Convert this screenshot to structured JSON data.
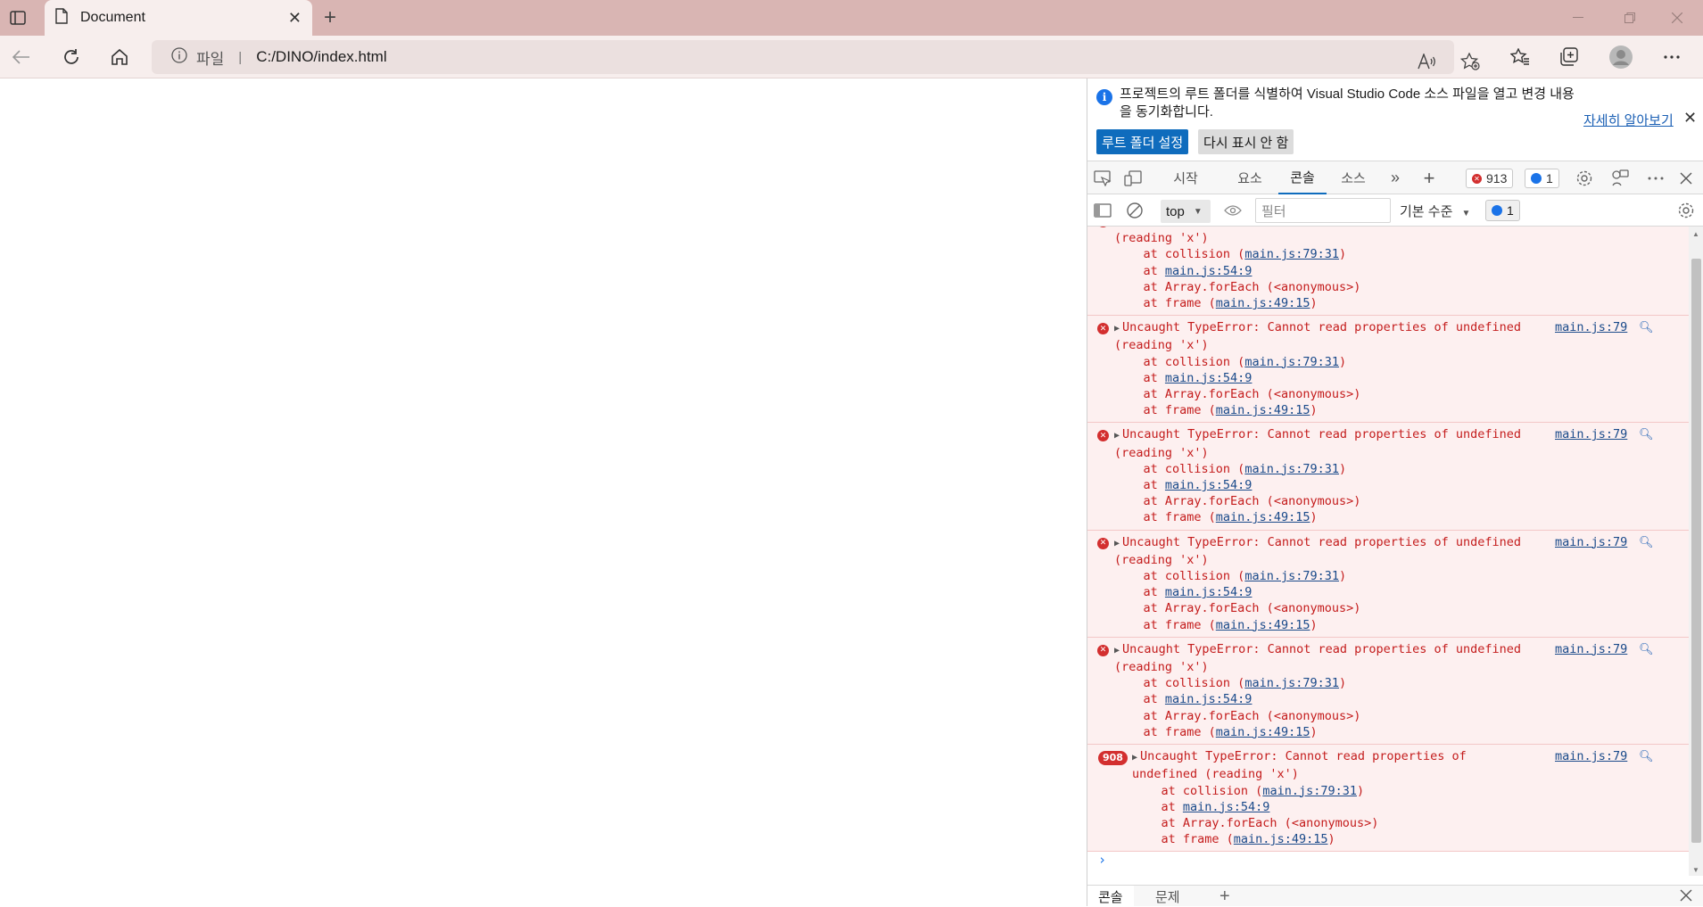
{
  "browser": {
    "tab_title": "Document",
    "new_tab": "+",
    "url_protocol": "파일",
    "url_separator": "|",
    "url": "C:/DINO/index.html"
  },
  "infobar": {
    "text": "프로젝트의 루트 폴더를 식별하여 Visual Studio Code 소스 파일을 열고 변경 내용을 동기화합니다.",
    "learn_more": "자세히 알아보기",
    "primary_button": "루트 폴더 설정",
    "secondary_button": "다시 표시 안 함"
  },
  "devtools_tabs": {
    "start": "시작",
    "elements": "요소",
    "console": "콘솔",
    "sources": "소스",
    "more": "»",
    "add": "+",
    "error_count": "913",
    "message_count": "1"
  },
  "console_toolbar": {
    "context": "top",
    "filter_placeholder": "필터",
    "level": "기본 수준",
    "message_count": "1"
  },
  "log": {
    "message": "Uncaught TypeError: Cannot read properties of undefined",
    "message_cont": "(reading 'x')",
    "message_grouped_1": "Uncaught TypeError: Cannot read properties of",
    "message_grouped_2": "undefined (reading 'x')",
    "trace_collision_prefix": "at collision (",
    "trace_collision_link": "main.js:79:31",
    "trace_close": ")",
    "trace_at": "at ",
    "trace_54_link": "main.js:54:9",
    "trace_foreach": "at Array.forEach (<anonymous>)",
    "trace_frame_prefix": "at frame (",
    "trace_frame_link": "main.js:49:15",
    "source": "main.js:79",
    "group_count": "908",
    "prompt": "›"
  },
  "drawer": {
    "console": "콘솔",
    "issues": "문제",
    "add": "+"
  }
}
